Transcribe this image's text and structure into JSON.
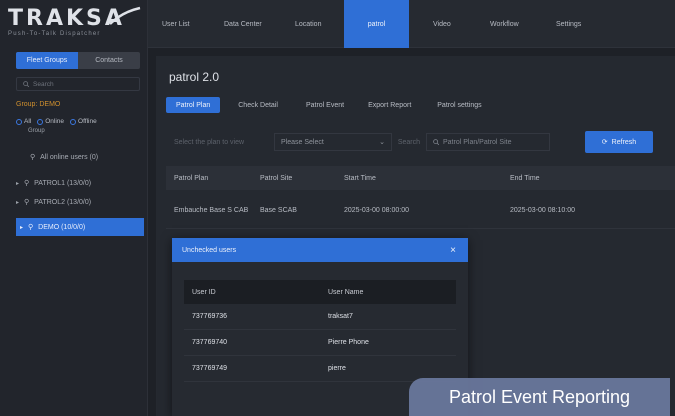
{
  "brand": {
    "word": "TRAKSA",
    "tagline": "Push-To-Talk Dispatcher"
  },
  "left_panel": {
    "tabs": [
      "Fleet Groups",
      "Contacts"
    ],
    "search_placeholder": "Search",
    "group_title": "Group: DEMO",
    "filter": {
      "all": "All",
      "online": "Online",
      "offline": "Offline",
      "sub": "Group"
    },
    "tree": [
      {
        "label": "All online users (0)",
        "arrow": "",
        "selected": false
      },
      {
        "label": "PATROL1 (13/0/0)",
        "arrow": "▸",
        "selected": false
      },
      {
        "label": "PATROL2 (13/0/0)",
        "arrow": "▸",
        "selected": false
      },
      {
        "label": "DEMO (10/0/0)",
        "arrow": "▸",
        "selected": true
      }
    ]
  },
  "nav": {
    "items": [
      "User List",
      "Data Center",
      "Location",
      "patrol",
      "Video",
      "Workflow",
      "Settings"
    ],
    "active_index": 3
  },
  "page": {
    "title": "patrol 2.0",
    "tabs": [
      "Patrol Plan",
      "Check Detail",
      "Patrol Event",
      "Export Report",
      "Patrol settings"
    ],
    "active_tab": 0,
    "filter": {
      "plan_placeholder": "Select the plan to view",
      "select_value": "Please Select",
      "search_label": "Search",
      "search_placeholder": "Patrol Plan/Patrol Site",
      "refresh_label": "Refresh"
    },
    "table": {
      "headers": [
        "Patrol Plan",
        "Patrol Site",
        "Start Time",
        "End Time"
      ],
      "rows": [
        [
          "Embauche Base S CAB",
          "Base SCAB",
          "2025-03-00 08:00:00",
          "2025-03-00 08:10:00"
        ]
      ]
    }
  },
  "modal": {
    "title": "Unchecked users",
    "close": "×",
    "headers": [
      "User ID",
      "User Name"
    ],
    "rows": [
      [
        "737769736",
        "traksat7"
      ],
      [
        "737769740",
        "Pierre Phone"
      ],
      [
        "737769749",
        "pierre"
      ]
    ]
  },
  "caption": "Patrol Event Reporting",
  "colors": {
    "accent": "#2f6fd6",
    "group_title": "#d0902e",
    "caption_bg": "#6b789e"
  },
  "icons": {
    "search": "search-icon",
    "refresh": "refresh-icon",
    "close": "close-icon",
    "user": "user-icon",
    "chevron": "chevron-down-icon"
  }
}
